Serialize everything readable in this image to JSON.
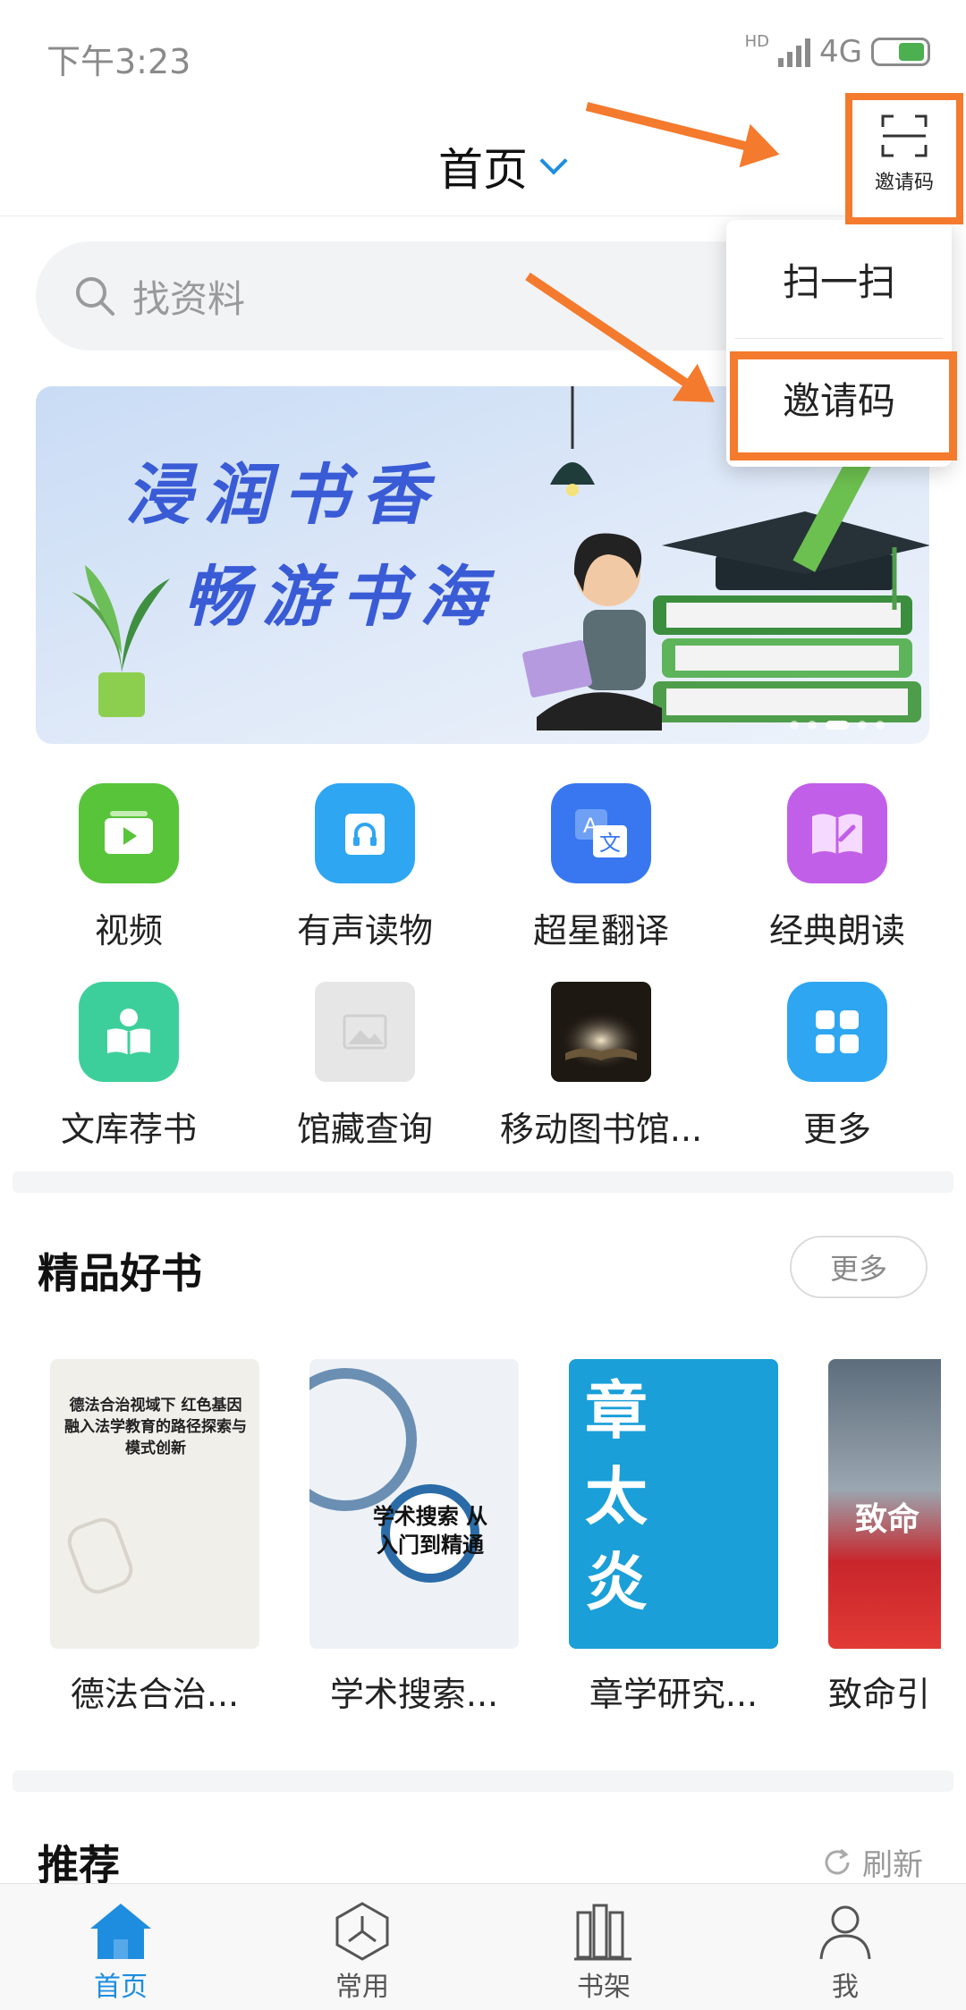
{
  "status_bar": {
    "time": "下午3:23",
    "hd": "HD",
    "network": "4G"
  },
  "header": {
    "title": "首页",
    "scan_label": "邀请码"
  },
  "search": {
    "placeholder": "找资料"
  },
  "popup_menu": {
    "items": [
      {
        "label": "扫一扫"
      },
      {
        "label": "邀请码"
      }
    ]
  },
  "banner": {
    "line1": "浸润书香",
    "line2": "畅游书海"
  },
  "grid": {
    "row1": [
      {
        "label": "视频",
        "icon": "video-icon",
        "color": "#58c43a"
      },
      {
        "label": "有声读物",
        "icon": "headphones-icon",
        "color": "#2ea6f2"
      },
      {
        "label": "超星翻译",
        "icon": "translate-icon",
        "color": "#3877f0"
      },
      {
        "label": "经典朗读",
        "icon": "book-reading-icon",
        "color": "#c25fe8"
      }
    ],
    "row2": [
      {
        "label": "文库荐书",
        "icon": "reader-icon",
        "color": "#3dcf9b"
      },
      {
        "label": "馆藏查询",
        "icon": "image-placeholder-icon",
        "color": "#e6e6e6"
      },
      {
        "label": "移动图书馆...",
        "icon": "library-book-icon",
        "color": "#2b241c"
      },
      {
        "label": "更多",
        "icon": "grid-more-icon",
        "color": "#2ea6f2"
      }
    ]
  },
  "featured": {
    "title": "精品好书",
    "more_label": "更多",
    "books": [
      {
        "title": "德法合治...",
        "cover_text": "德法合治视域下 红色基因融入法学教育的路径探索与模式创新"
      },
      {
        "title": "学术搜索...",
        "cover_text": "学术搜索 从入门到精通"
      },
      {
        "title": "章学研究...",
        "cover_text": "章太炎"
      },
      {
        "title": "致命引",
        "cover_text": "致命"
      }
    ]
  },
  "recommend": {
    "title": "推荐",
    "refresh_label": "刷新"
  },
  "tabbar": {
    "items": [
      {
        "label": "首页",
        "icon": "home-icon",
        "active": true
      },
      {
        "label": "常用",
        "icon": "frequent-icon",
        "active": false
      },
      {
        "label": "书架",
        "icon": "bookshelf-icon",
        "active": false
      },
      {
        "label": "我",
        "icon": "profile-icon",
        "active": false
      }
    ]
  },
  "colors": {
    "accent": "#1e8de0",
    "annotation": "#f47a2d"
  }
}
